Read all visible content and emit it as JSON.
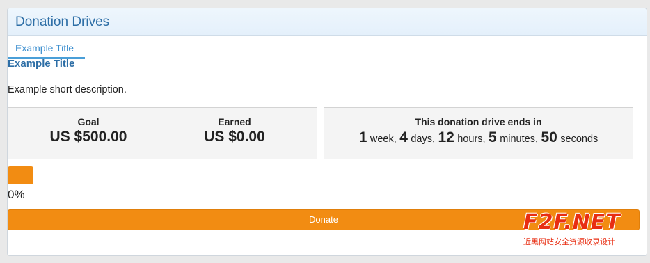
{
  "panel": {
    "heading": "Donation Drives",
    "tab_label": "Example Title"
  },
  "drive": {
    "title": "Example Title",
    "description": "Example short description.",
    "goal_label": "Goal",
    "goal_value": "US $500.00",
    "earned_label": "Earned",
    "earned_value": "US $0.00",
    "timer_label": "This donation drive ends in",
    "timer": {
      "weeks": "1",
      "weeks_unit": "week,",
      "days": "4",
      "days_unit": "days,",
      "hours": "12",
      "hours_unit": "hours,",
      "minutes": "5",
      "minutes_unit": "minutes,",
      "seconds": "50",
      "seconds_unit": "seconds"
    },
    "progress_percent": 0,
    "progress_text": "0%",
    "donate_label": "Donate"
  },
  "colors": {
    "accent": "#f28c12",
    "heading_text": "#2d6ea6",
    "tab_underline": "#4a9fd8"
  },
  "watermark": {
    "logo": "F2F.NET",
    "subtitle": "近黑网站安全资源收录设计"
  }
}
